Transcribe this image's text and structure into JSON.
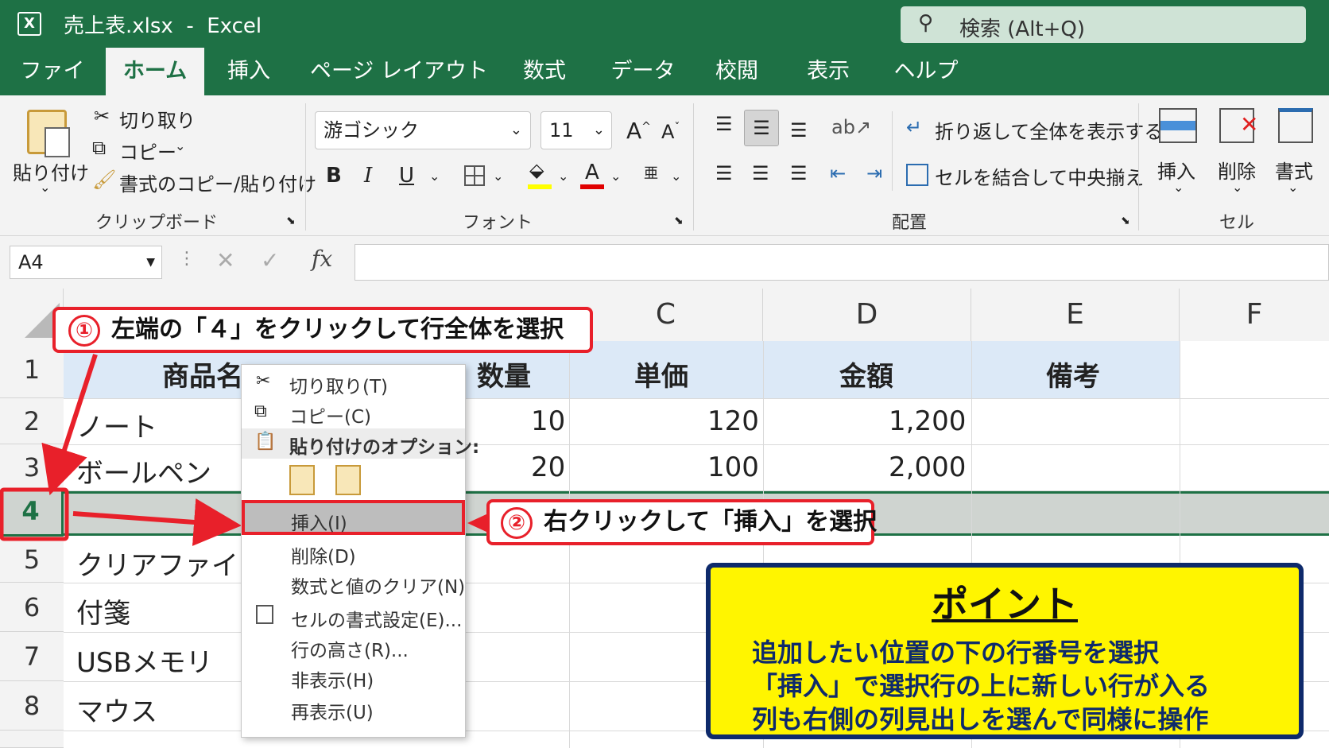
{
  "title": {
    "app_icon": "excel-logo-icon",
    "text": "売上表.xlsx  -  Excel"
  },
  "search": {
    "placeholder": "検索 (Alt+Q)"
  },
  "tabs": [
    "ファイル",
    "ホーム",
    "挿入",
    "ページ レイアウト",
    "数式",
    "データ",
    "校閲",
    "表示",
    "ヘルプ"
  ],
  "active_tab": "ホーム",
  "ribbon": {
    "clipboard": {
      "paste": "貼り付け",
      "cut": "切り取り",
      "copy": "コピー",
      "format_painter": "書式のコピー/貼り付け",
      "group": "クリップボード"
    },
    "font": {
      "name": "游ゴシック",
      "size": "11",
      "bold": "B",
      "italic": "I",
      "underline": "U",
      "grow": "A",
      "shrink": "A",
      "fontcolor": "A",
      "group": "フォント",
      "fill_color": "#ffff00",
      "font_color_bar": "#e00000"
    },
    "alignment": {
      "wrap": "折り返して全体を表示する",
      "merge": "セルを結合して中央揃え",
      "group": "配置"
    },
    "cells": {
      "insert": "挿入",
      "delete": "削除",
      "format": "書式",
      "group": "セル"
    }
  },
  "formula_bar": {
    "name_box": "A4",
    "fx": "fx",
    "value": ""
  },
  "columns": [
    "C",
    "D",
    "E",
    "F"
  ],
  "rows": [
    {
      "num": "1",
      "a": "商品名",
      "b": "数量",
      "c": "単価",
      "d": "金額",
      "e": "備考"
    },
    {
      "num": "2",
      "a": "ノート",
      "b": "10",
      "c": "120",
      "d": "1,200"
    },
    {
      "num": "3",
      "a": "ボールペン",
      "b": "20",
      "c": "100",
      "d": "2,000"
    },
    {
      "num": "4",
      "a": "",
      "b": "",
      "c": "",
      "d": ""
    },
    {
      "num": "5",
      "a": "クリアファイ"
    },
    {
      "num": "6",
      "a": "付箋"
    },
    {
      "num": "7",
      "a": "USBメモリ"
    },
    {
      "num": "8",
      "a": "マウス"
    }
  ],
  "context_menu": {
    "cut": "切り取り(T)",
    "copy": "コピー(C)",
    "paste_options": "貼り付けのオプション:",
    "insert": "挿入(I)",
    "delete": "削除(D)",
    "clear": "数式と値のクリア(N)",
    "format_cells": "セルの書式設定(E)...",
    "row_height": "行の高さ(R)...",
    "hide": "非表示(H)",
    "unhide": "再表示(U)"
  },
  "annotations": {
    "step1_num": "①",
    "step1": "左端の「４」をクリックして行全体を選択",
    "step2_num": "②",
    "step2": "右クリックして「挿入」を選択"
  },
  "point": {
    "title": "ポイント",
    "lines": [
      "追加したい位置の下の行番号を選択",
      "「挿入」で選択行の上に新しい行が入る",
      "列も右側の列見出しを選んで同様に操作"
    ]
  },
  "colors": {
    "excel_green": "#1e7145",
    "header_blue": "#dce9f7",
    "selected_row": "#cfd4d0",
    "red": "#e8202a",
    "point_bg": "#fff500",
    "point_border": "#0e2a6b"
  }
}
